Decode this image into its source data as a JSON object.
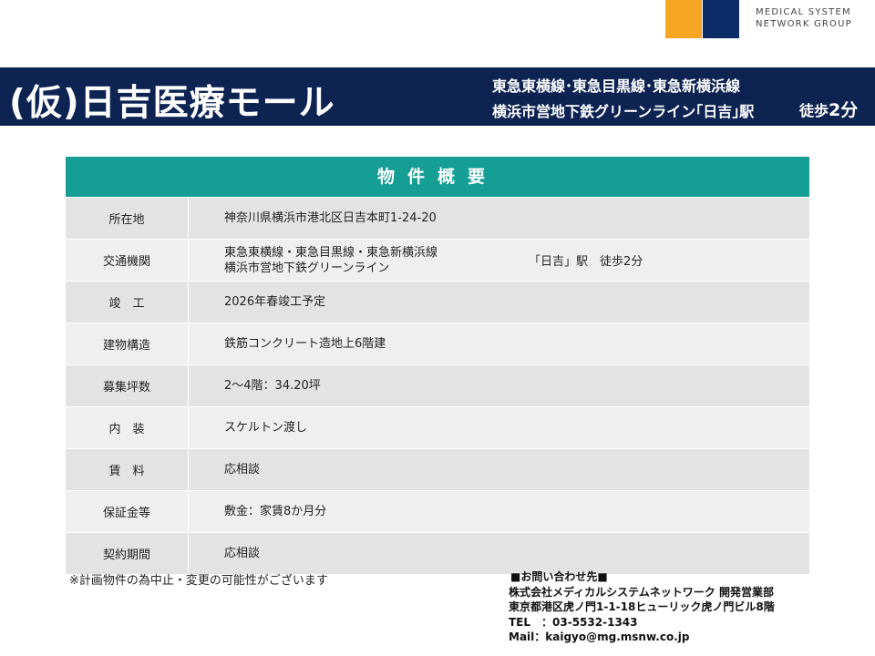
{
  "logo": {
    "line1": "MEDICAL SYSTEM",
    "line2": "NETWORK GROUP",
    "colors": {
      "orange": "#f5a623",
      "navy": "#0d2b66"
    }
  },
  "banner": {
    "title": "(仮)日吉医療モール",
    "line1": "東急東横線･東急目黒線･東急新横浜線",
    "line2": "横浜市営地下鉄グリーンライン｢日吉｣駅",
    "walk_prefix": "徒歩",
    "walk_value": "2分",
    "bg_color": "#0d2352"
  },
  "table": {
    "header": "物件概要",
    "header_color": "#149e94",
    "rows": [
      {
        "label": "所在地",
        "value": "神奈川県横浜市港北区日吉本町1-24-20"
      },
      {
        "label": "交通機関",
        "value_line1": "東急東横線・東急目黒線・東急新横浜線",
        "value_line2": "横浜市営地下鉄グリーンライン",
        "value_right": "「日吉」駅　徒歩2分"
      },
      {
        "label": "竣　工",
        "value": "2026年春竣工予定"
      },
      {
        "label": "建物構造",
        "value": "鉄筋コンクリート造地上6階建"
      },
      {
        "label": "募集坪数",
        "value": "2～4階：34.20坪"
      },
      {
        "label": "内　装",
        "value": "スケルトン渡し"
      },
      {
        "label": "賃　料",
        "value": "応相談"
      },
      {
        "label": "保証金等",
        "value": "敷金：家賃8か月分"
      },
      {
        "label": "契約期間",
        "value": "応相談"
      }
    ]
  },
  "note": "※計画物件の為中止・変更の可能性がございます",
  "contact": {
    "heading": "■お問い合わせ先■",
    "company": "株式会社メディカルシステムネットワーク 開発営業部",
    "address": "東京都港区虎ノ門1-1-18ヒューリック虎ノ門ビル8階",
    "tel": "TEL　：03-5532-1343",
    "mail": "Mail：kaigyo@mg.msnw.co.jp"
  }
}
